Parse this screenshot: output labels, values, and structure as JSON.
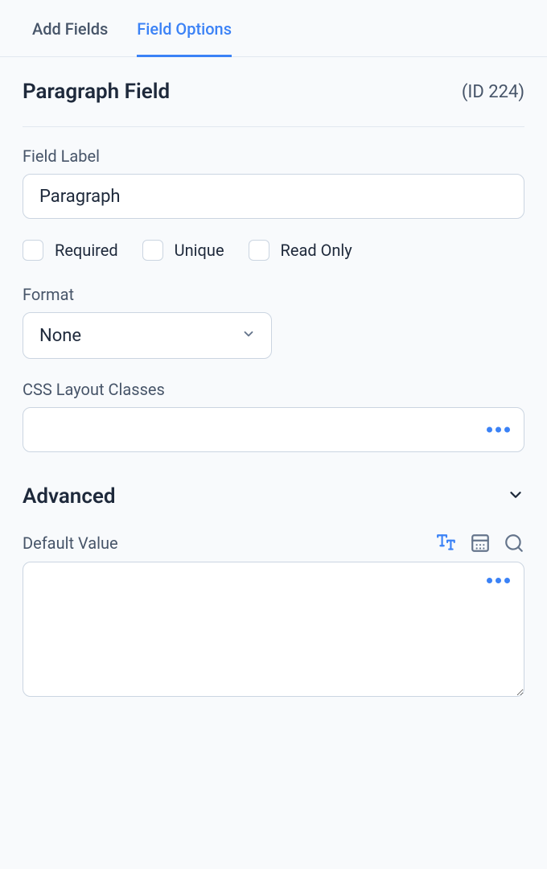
{
  "tabs": {
    "add_fields": "Add Fields",
    "field_options": "Field Options"
  },
  "header": {
    "title": "Paragraph Field",
    "id_label": "(ID 224)"
  },
  "field_label": {
    "label": "Field Label",
    "value": "Paragraph"
  },
  "checkboxes": {
    "required": "Required",
    "unique": "Unique",
    "read_only": "Read Only"
  },
  "format": {
    "label": "Format",
    "value": "None"
  },
  "css_classes": {
    "label": "CSS Layout Classes",
    "value": ""
  },
  "advanced": {
    "title": "Advanced"
  },
  "default_value": {
    "label": "Default Value",
    "value": ""
  }
}
